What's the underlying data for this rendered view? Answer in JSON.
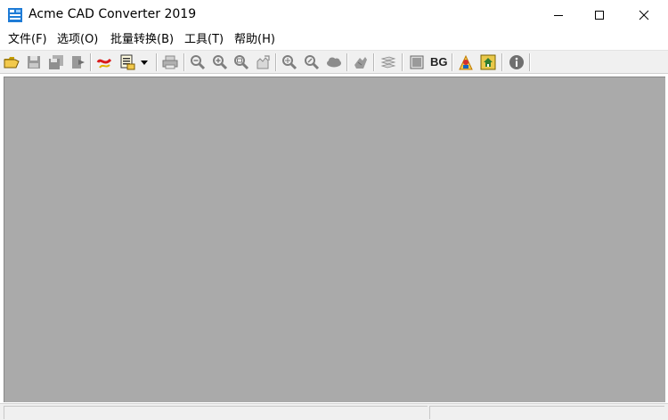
{
  "window": {
    "title": "Acme CAD Converter 2019",
    "controls": {
      "minimize": "minimize",
      "maximize": "maximize",
      "close": "close"
    }
  },
  "menubar": {
    "items": [
      {
        "id": "file",
        "label": "文件(F)"
      },
      {
        "id": "options",
        "label": "选项(O)"
      },
      {
        "id": "batch",
        "label": "批量转换(B)"
      },
      {
        "id": "tools",
        "label": "工具(T)"
      },
      {
        "id": "help",
        "label": "帮助(H)"
      }
    ]
  },
  "toolbar": {
    "bg_label": "BG",
    "icons": [
      "open-folder-icon",
      "save-icon",
      "save-all-icon",
      "export-icon",
      "pdf-convert-icon",
      "batch-convert-icon",
      "dropdown-arrow-icon",
      "print-icon",
      "zoom-out-icon",
      "zoom-in-icon",
      "zoom-window-icon",
      "zoom-pan-icon",
      "zoom-extents-icon",
      "zoom-realtime-icon",
      "cloud-icon",
      "layers-icon",
      "layer-list-icon",
      "black-background-icon",
      "bg-icon",
      "user-icon",
      "home-icon",
      "info-icon"
    ]
  },
  "statusbar": {
    "left": "",
    "right": ""
  },
  "colors": {
    "client_background": "#aaaaaa",
    "toolbar_background": "#f0f0f0",
    "title_icon": "#1e7bd6"
  }
}
